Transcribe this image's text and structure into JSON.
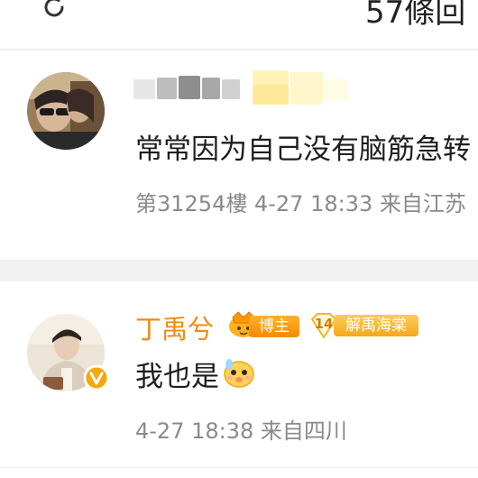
{
  "header": {
    "refresh_icon": "refresh-icon",
    "reply_count": "57條回"
  },
  "comments": [
    {
      "username_obscured": true,
      "text": "常常因为自己没有脑筋急转",
      "meta": "第31254樓  4-27 18:33  来自江苏"
    },
    {
      "username": "丁禹兮",
      "badge_host": "博主",
      "badge_fan_level": "14",
      "badge_fan": "解禹海棠",
      "text": "我也是",
      "emoji": "cute-face-emoji",
      "meta": "4-27 18:38  来自四川",
      "verified": "verified-v-icon"
    }
  ],
  "colors": {
    "username": "#f08a12",
    "meta": "#8a8a8a",
    "badge_orange": "#f58a00",
    "badge_gold": "#f6a81b"
  }
}
